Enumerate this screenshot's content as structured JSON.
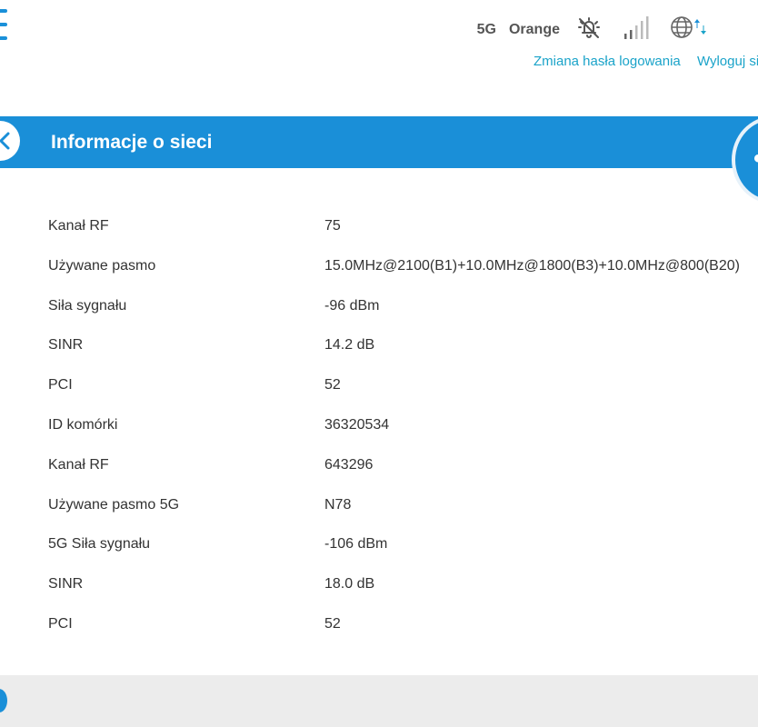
{
  "status_bar": {
    "network_type": "5G",
    "carrier": "Orange",
    "icons": [
      "menu-icon",
      "notification-muted-icon",
      "signal-strength-icon",
      "globe-data-icon"
    ]
  },
  "links": {
    "change_password": "Zmiana hasła logowania",
    "logout": "Wyloguj się"
  },
  "section": {
    "title": "Informacje o sieci"
  },
  "info_rows": [
    {
      "label": "Kanał RF",
      "value": "75"
    },
    {
      "label": "Używane pasmo",
      "value": "15.0MHz@2100(B1)+10.0MHz@1800(B3)+10.0MHz@800(B20)"
    },
    {
      "label": "Siła sygnału",
      "value": "-96 dBm"
    },
    {
      "label": "SINR",
      "value": "14.2 dB"
    },
    {
      "label": "PCI",
      "value": "52"
    },
    {
      "label": "ID komórki",
      "value": "36320534"
    },
    {
      "label": "Kanał RF",
      "value": "643296"
    },
    {
      "label": "Używane pasmo 5G",
      "value": "N78"
    },
    {
      "label": "5G Siła sygnału",
      "value": "-106 dBm"
    },
    {
      "label": "SINR",
      "value": "18.0 dB"
    },
    {
      "label": "PCI",
      "value": "52"
    }
  ],
  "colors": {
    "accent": "#1a8fd8",
    "link": "#1aa3c9",
    "footer": "#ececec"
  }
}
